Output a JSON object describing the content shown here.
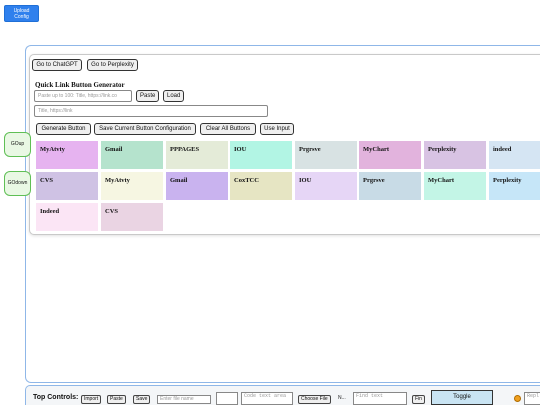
{
  "upload": {
    "line1": "Upload",
    "line2": "Config"
  },
  "nav": {
    "chatgpt": "Go to ChatGPT",
    "perplexity": "Go to Perplexity"
  },
  "generator": {
    "title": "Quick Link Button Generator",
    "paste_placeholder": "Paste up to 100: Title, https://link.co",
    "paste_label": "Paste",
    "load_label": "Load",
    "title_link_placeholder": "Title, https://link",
    "generate_label": "Generate Button",
    "save_config_label": "Save Current Button Configuration",
    "clear_label": "Clear All Buttons",
    "use_input_label": "Use Input"
  },
  "side": {
    "up": "GOup",
    "down": "GOdown"
  },
  "tiles": [
    {
      "label": "MyAtvty",
      "color": "#e6b3f0"
    },
    {
      "label": "Gmail",
      "color": "#b5e3cd"
    },
    {
      "label": "PPPAGES",
      "color": "#e4ebd8"
    },
    {
      "label": "IOU",
      "color": "#b2f5e4"
    },
    {
      "label": "Prgrsve",
      "color": "#d8e2e3"
    },
    {
      "label": "MyChart",
      "color": "#e2b3dd"
    },
    {
      "label": "Perplexity",
      "color": "#d8c3e3"
    },
    {
      "label": "indeed",
      "color": "#d5e5f3"
    },
    {
      "label": "CVS",
      "color": "#cfc2e4"
    },
    {
      "label": "MyAtvty",
      "color": "#f6f6e2"
    },
    {
      "label": "Gmail",
      "color": "#c9b3ef"
    },
    {
      "label": "CoxTCC",
      "color": "#e6e5c3"
    },
    {
      "label": "IOU",
      "color": "#e6d6f6"
    },
    {
      "label": "Prgrsve",
      "color": "#c8dbe6"
    },
    {
      "label": "MyChart",
      "color": "#c3f5e6"
    },
    {
      "label": "Perplexity",
      "color": "#c6e6f8"
    },
    {
      "label": "Indeed",
      "color": "#fbe5f5"
    },
    {
      "label": "CVS",
      "color": "#ead4e3"
    }
  ],
  "bottom": {
    "label": "Top Controls:",
    "import_label": "Import",
    "paste_label": "Paste",
    "save_label": "Save",
    "filename_placeholder": "Enter file name",
    "code_placeholder": "Code text area",
    "choose_file_label": "Choose File",
    "no_file_text": "N...",
    "find_placeholder": "Find text",
    "fin_label": "Fin",
    "toggle_label": "Toggle HTML/Rendered",
    "replace_placeholder": "Repl"
  }
}
